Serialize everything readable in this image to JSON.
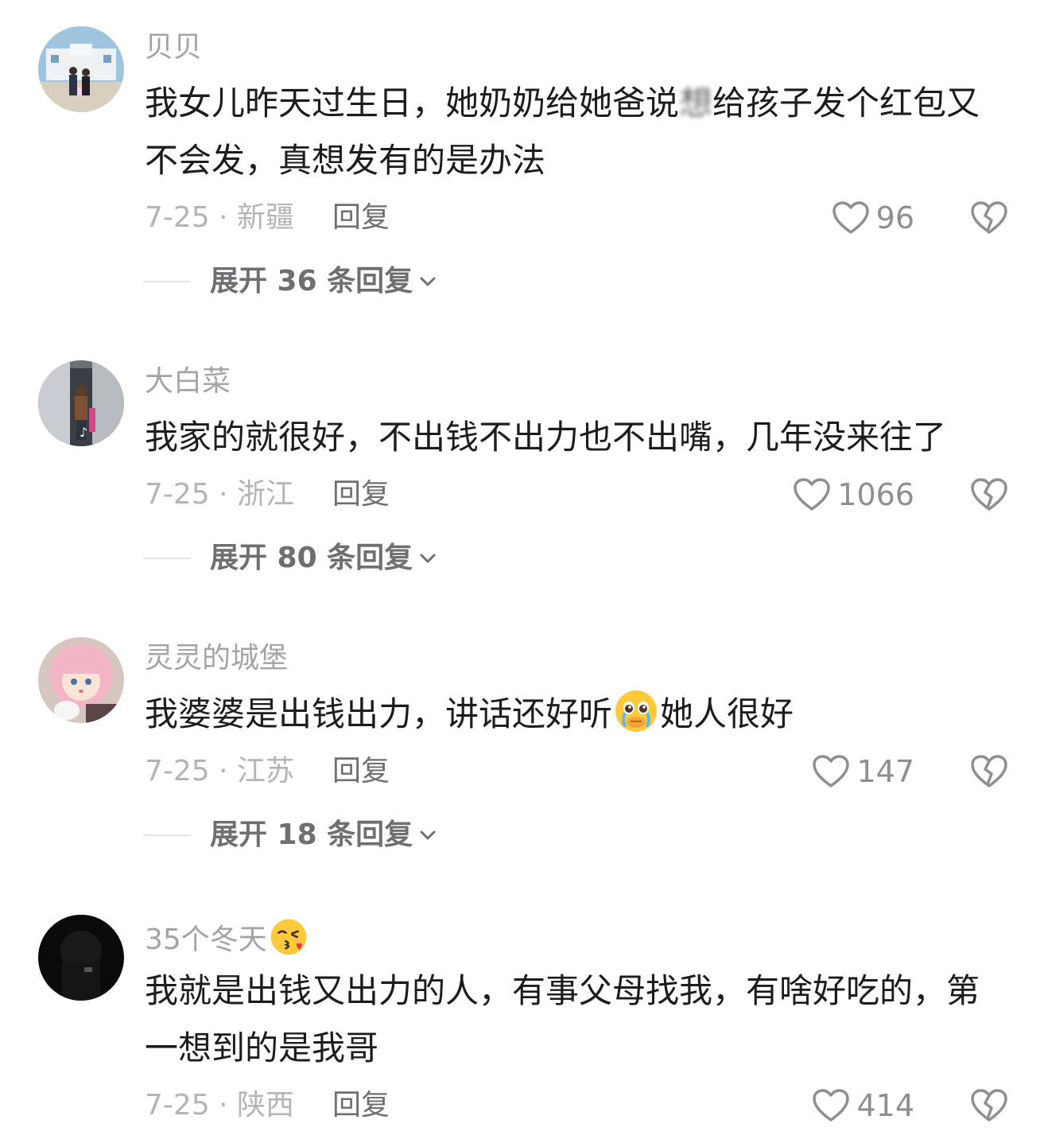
{
  "comments": [
    {
      "username": "贝贝",
      "text_before": "我女儿昨天过生日，她奶奶给她爸说",
      "text_blurred": "想",
      "text_after": "给孩子发个红包又不会发，真想发有的是办法",
      "date_location": "7-25 · 新疆",
      "reply_label": "回复",
      "likes": "96",
      "expand_label": "展开 36 条回复"
    },
    {
      "username": "大白菜",
      "text": "我家的就很好，不出钱不出力也不出嘴，几年没来往了",
      "date_location": "7-25 · 浙江",
      "reply_label": "回复",
      "likes": "1066",
      "expand_label": "展开 80 条回复"
    },
    {
      "username": "灵灵的城堡",
      "text_before": "我婆婆是出钱出力，讲话还好听",
      "emoji": "pleading-face-emoji",
      "text_after": "她人很好",
      "date_location": "7-25 · 江苏",
      "reply_label": "回复",
      "likes": "147",
      "expand_label": "展开 18 条回复"
    },
    {
      "username": "35个冬天",
      "username_emoji": "kissing-heart-emoji",
      "text": "我就是出钱又出力的人，有事父母找我，有啥好吃的，第一想到的是我哥",
      "date_location": "7-25 · 陕西",
      "reply_label": "回复",
      "likes": "414"
    }
  ],
  "icons": {
    "like": "heart-outline-icon",
    "dislike": "broken-heart-icon",
    "expand": "chevron-down-icon"
  },
  "colors": {
    "username": "#a3a3a8",
    "body": "#1c1c1e",
    "meta": "#b3b3b8",
    "secondary": "#6e6e73"
  }
}
